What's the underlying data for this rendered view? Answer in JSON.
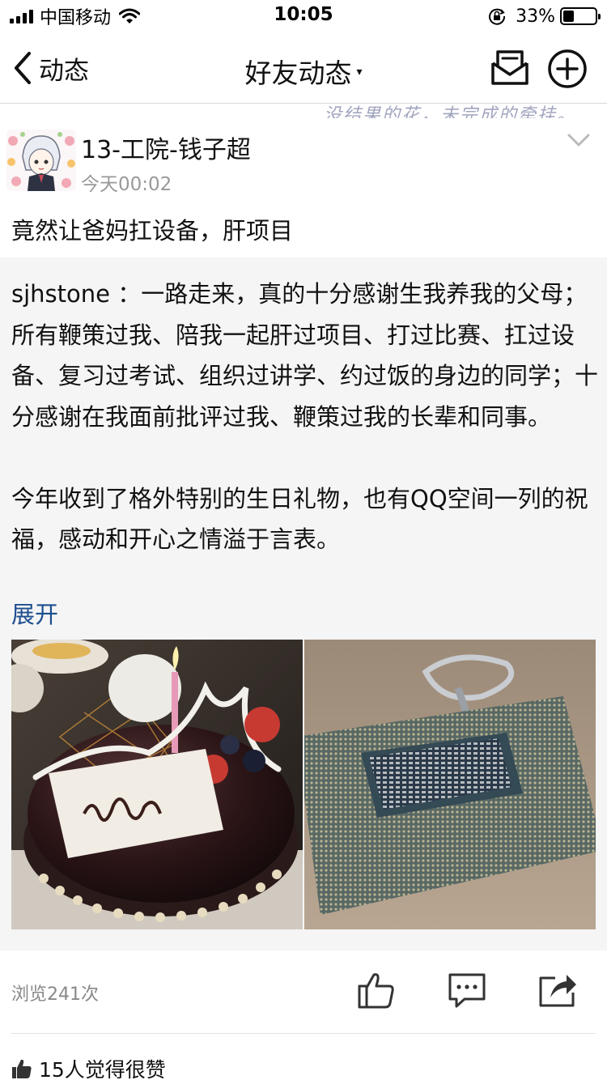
{
  "status_bar": {
    "carrier": "中国移动",
    "time": "10:05",
    "battery": "33%",
    "battery_level": 0.33
  },
  "nav": {
    "back_label": "动态",
    "title": "好友动态",
    "title_caret": "▾"
  },
  "banner_text": "没结果的花，未完成的牵挂。",
  "post": {
    "author": "13-工院-钱子超",
    "time": "今天00:02",
    "caption": "竟然让爸妈扛设备，肝项目",
    "forwarded": {
      "user": "sjhstone",
      "separator": " ：",
      "text": "一路走来，真的十分感谢生我养我的父母；所有鞭策过我、陪我一起肝过项目、打过比赛、扛过设备、复习过考试、组织过讲学、约过饭的身边的同学；十分感谢在我面前批评过我、鞭策过我的长辈和同事。\n\n今年收到了格外特别的生日礼物，也有QQ空间一列的祝福，感动和开心之情溢于言表。",
      "expand_label": "展开"
    },
    "views": "浏览241次",
    "likes": "15人觉得很赞"
  }
}
